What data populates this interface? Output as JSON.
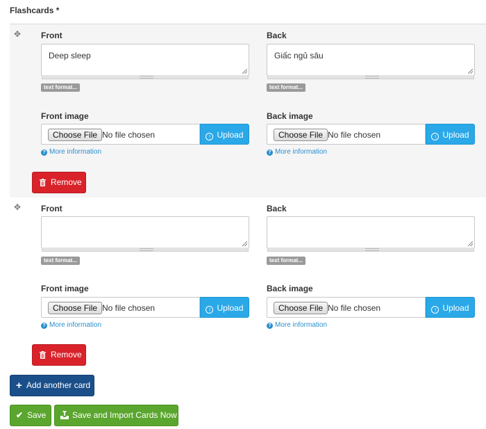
{
  "section": {
    "title": "Flashcards",
    "required_mark": "*"
  },
  "cards": [
    {
      "front_label": "Front",
      "front_value": "Deep sleep",
      "back_label": "Back",
      "back_value": "Giấc ngủ sâu",
      "text_format_label": "text format...",
      "front_image_label": "Front image",
      "back_image_label": "Back image",
      "choose_file_label": "Choose File",
      "no_file_label": "No file chosen",
      "upload_label": "Upload",
      "more_info_label": "More information",
      "remove_label": "Remove"
    },
    {
      "front_label": "Front",
      "front_value": "",
      "back_label": "Back",
      "back_value": "",
      "text_format_label": "text format...",
      "front_image_label": "Front image",
      "back_image_label": "Back image",
      "choose_file_label": "Choose File",
      "no_file_label": "No file chosen",
      "upload_label": "Upload",
      "more_info_label": "More information",
      "remove_label": "Remove"
    }
  ],
  "actions": {
    "add_card_label": "Add another card",
    "save_label": "Save",
    "save_import_label": "Save and Import Cards Now"
  },
  "icons": {
    "drag": "move-icon",
    "upload": "upload-circle-icon",
    "info": "question-circle-icon",
    "remove": "trash-icon",
    "add": "plus-icon",
    "save": "check-icon",
    "import": "import-icon"
  },
  "colors": {
    "upload": "#2aa8e8",
    "remove": "#d9222a",
    "add": "#1b4f8a",
    "save": "#5ba62e",
    "link": "#2a8fce"
  }
}
